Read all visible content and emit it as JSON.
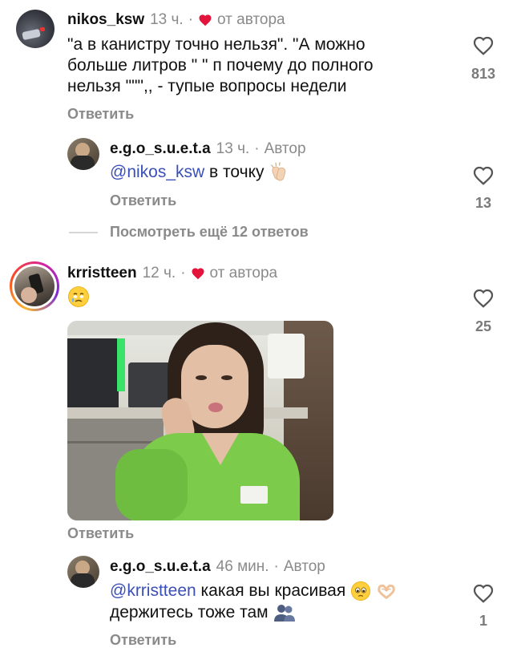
{
  "comments": [
    {
      "username": "nikos_ksw",
      "time": "13 ч.",
      "author_badge": "от автора",
      "text": "\"а в канистру точно нельзя\". \"А можно больше литров \" \" п почему до полного нельзя \"\"\",, - тупые вопросы недели",
      "reply_label": "Ответить",
      "likes": "813",
      "replies": [
        {
          "username": "e.g.o_s.u.e.t.a",
          "time": "13 ч.",
          "author_tag": "Автор",
          "mention": "@nikos_ksw",
          "text": "в точку",
          "emoji": "clapping-hands",
          "reply_label": "Ответить",
          "likes": "13"
        }
      ],
      "view_more": "Посмотреть ещё 12 ответов"
    },
    {
      "username": "krristteen",
      "time": "12 ч.",
      "author_badge": "от автора",
      "emoji": "face-holding-back-tears",
      "reply_label": "Ответить",
      "likes": "25",
      "replies": [
        {
          "username": "e.g.o_s.u.e.t.a",
          "time": "46 мин.",
          "author_tag": "Автор",
          "mention": "@krristteen",
          "text_line1": "какая вы красивая",
          "text_line2": "держитесь тоже там",
          "reply_label": "Ответить",
          "likes": "1"
        }
      ]
    }
  ],
  "colors": {
    "heart_red": "#e3143c",
    "mention": "#3b4fb8",
    "muted": "#8a8a8a"
  }
}
